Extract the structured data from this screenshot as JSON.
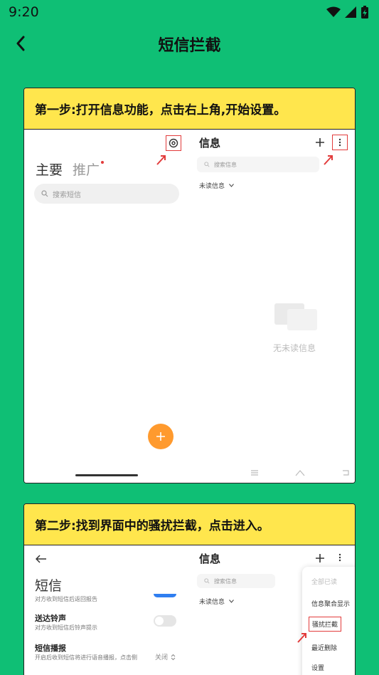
{
  "status_bar": {
    "time": "9:20"
  },
  "app_bar": {
    "title": "短信拦截"
  },
  "steps": [
    {
      "title": "第一步:打开信息功能，点击右上角,开始设置。",
      "left_screen": {
        "tab_primary": "主要",
        "tab_promo": "推广",
        "search_placeholder": "搜索短信"
      },
      "right_screen": {
        "title": "信息",
        "search_placeholder": "搜索信息",
        "filter_label": "未读信息",
        "empty_text": "无未读信息"
      }
    },
    {
      "title": "第二步:找到界面中的骚扰拦截，点击进入。",
      "left_screen": {
        "heading": "短信",
        "partial_text": "对方收到短信后返回报告",
        "setting1_title": "送达铃声",
        "setting1_desc": "对方收到短信后铃声提示",
        "setting2_title": "短信播报",
        "setting2_desc": "开启后收到短信将进行语音播报，点击侧",
        "setting2_value": "关闭"
      },
      "right_screen": {
        "title": "信息",
        "search_placeholder": "搜索信息",
        "filter_label": "未读信息",
        "menu_items": [
          "全部已读",
          "信息聚合显示",
          "骚扰拦截",
          "最近删除",
          "设置"
        ]
      }
    }
  ],
  "colors": {
    "background": "#0fbf75",
    "header": "#ffe64d",
    "accent": "#ff9a2e",
    "highlight": "#e23b3b"
  }
}
